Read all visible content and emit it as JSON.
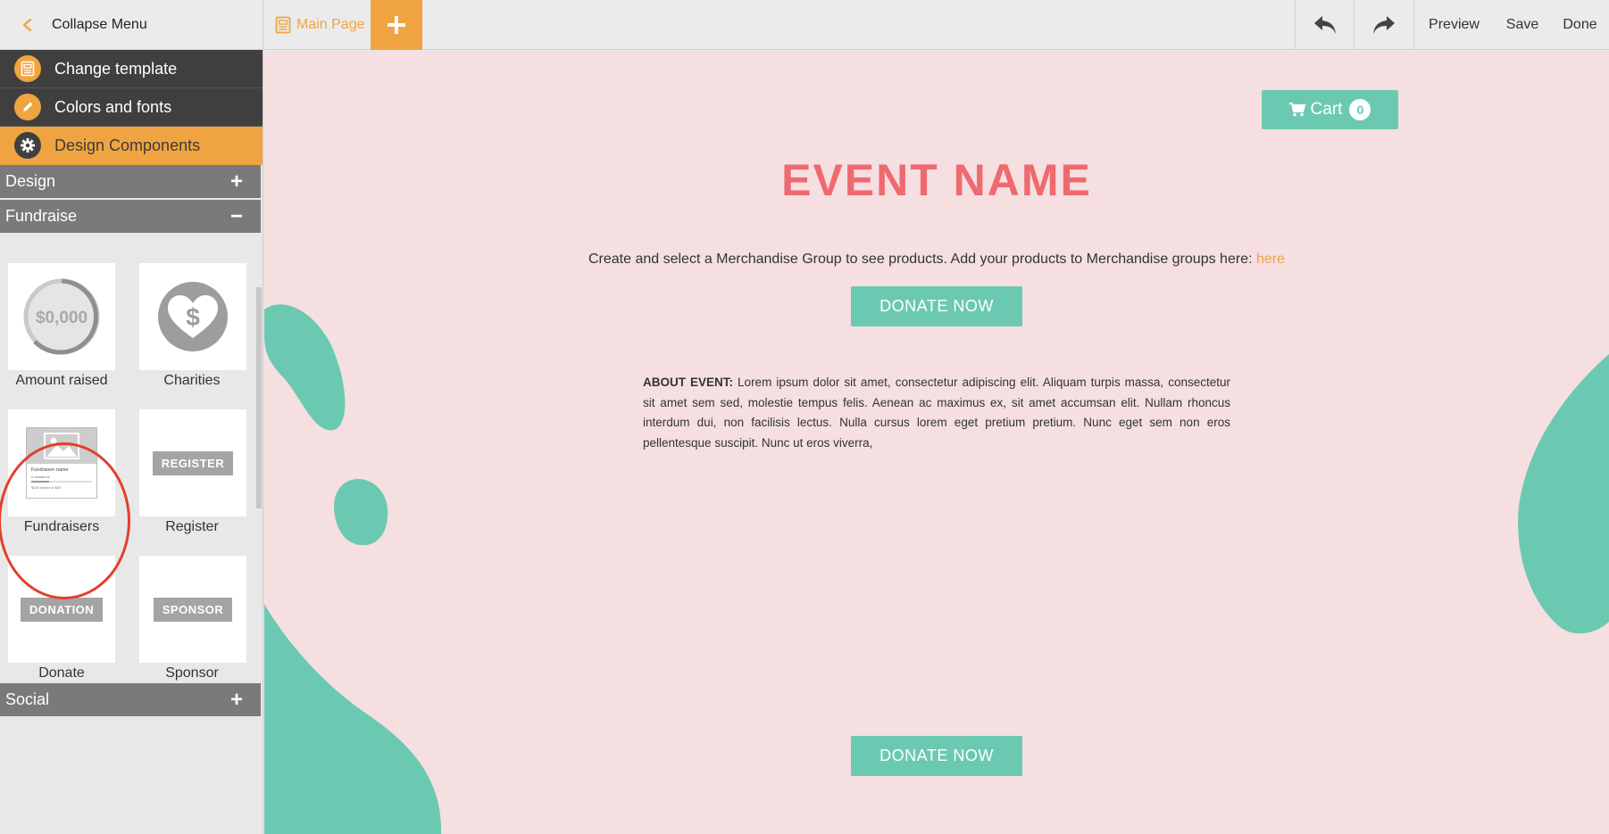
{
  "topbar": {
    "collapse_label": "Collapse Menu",
    "main_tab_label": "Main Page",
    "preview_label": "Preview",
    "save_label": "Save",
    "done_label": "Done"
  },
  "sidebar": {
    "menu": [
      {
        "label": "Change template",
        "icon": "template-icon"
      },
      {
        "label": "Colors and fonts",
        "icon": "pencil-icon"
      },
      {
        "label": "Design Components",
        "icon": "gear-icon"
      }
    ],
    "sections": {
      "design": {
        "label": "Design",
        "symbol": "+"
      },
      "fundraise": {
        "label": "Fundraise",
        "symbol": "−"
      },
      "social": {
        "label": "Social",
        "symbol": "+"
      }
    },
    "components": {
      "amount_raised": {
        "label": "Amount raised",
        "preview_text": "$0,000"
      },
      "charities": {
        "label": "Charities",
        "preview_text": "$"
      },
      "fundraisers": {
        "label": "Fundraisers",
        "preview_name": "Fundraiser name",
        "preview_donations": "# donations",
        "preview_raised": "$100 raised of $00"
      },
      "register": {
        "label": "Register",
        "preview_text": "REGISTER"
      },
      "donate": {
        "label": "Donate",
        "preview_text": "DONATION"
      },
      "sponsor": {
        "label": "Sponsor",
        "preview_text": "SPONSOR"
      }
    }
  },
  "canvas": {
    "cart_label": "Cart",
    "cart_count": "0",
    "event_title": "EVENT NAME",
    "merch_text": "Create and select a Merchandise Group to see products. Add your products to Merchandise groups here: ",
    "merch_link": "here",
    "donate_label_top": "DONATE NOW",
    "about_label": "ABOUT EVENT:",
    "about_text": " Lorem ipsum dolor sit amet, consectetur adipiscing elit. Aliquam turpis massa, consectetur sit amet sem sed, molestie tempus felis. Aenean ac maximus ex, sit amet accumsan elit. Nullam rhoncus interdum dui, non facilisis lectus. Nulla cursus lorem eget pretium pretium. Nunc eget sem non eros pellentesque suscipit. Nunc ut eros viverra,",
    "donate_label_bottom": "DONATE NOW"
  },
  "colors": {
    "accent": "#f0a441",
    "teal": "#6cc9b1",
    "title_red": "#ee6a6f",
    "canvas_bg": "#f5dfe1",
    "menu_dark": "#3f3f3f",
    "section_gray": "#7a7a7a",
    "highlight_red": "#e23f2c"
  }
}
